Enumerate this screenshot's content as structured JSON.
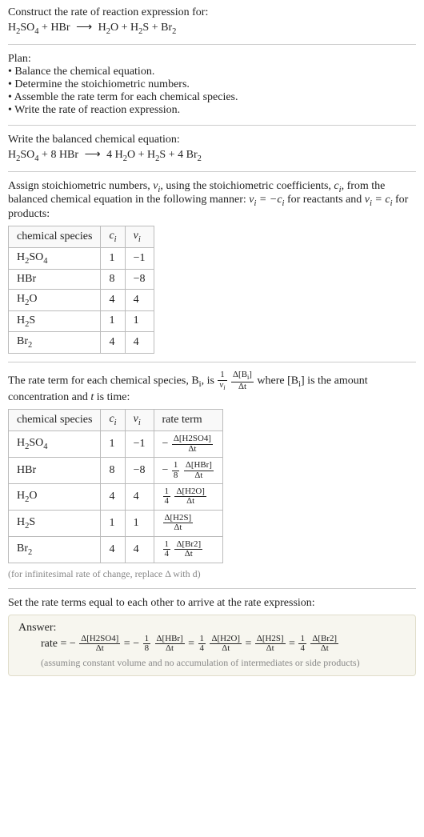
{
  "chart_data": [
    {
      "type": "table",
      "title": "Stoichiometric numbers",
      "columns": [
        "chemical species",
        "c_i",
        "ν_i"
      ],
      "rows": [
        [
          "H2SO4",
          1,
          -1
        ],
        [
          "HBr",
          8,
          -8
        ],
        [
          "H2O",
          4,
          4
        ],
        [
          "H2S",
          1,
          1
        ],
        [
          "Br2",
          4,
          4
        ]
      ]
    },
    {
      "type": "table",
      "title": "Rate terms",
      "columns": [
        "chemical species",
        "c_i",
        "ν_i",
        "rate term"
      ],
      "rows": [
        [
          "H2SO4",
          1,
          -1,
          "-Δ[H2SO4]/Δt"
        ],
        [
          "HBr",
          8,
          -8,
          "-(1/8) Δ[HBr]/Δt"
        ],
        [
          "H2O",
          4,
          4,
          "(1/4) Δ[H2O]/Δt"
        ],
        [
          "H2S",
          1,
          1,
          "Δ[H2S]/Δt"
        ],
        [
          "Br2",
          4,
          4,
          "(1/4) Δ[Br2]/Δt"
        ]
      ]
    }
  ],
  "intro": {
    "construct": "Construct the rate of reaction expression for:"
  },
  "unbalanced": {
    "r1": "H",
    "r1s": "2",
    "r1b": "SO",
    "r1bs": "4",
    "plus1": " + ",
    "r2": "HBr",
    "arrow": "⟶",
    "p1": "H",
    "p1s": "2",
    "p1b": "O",
    "plus2": " + ",
    "p2": "H",
    "p2s": "2",
    "p2b": "S",
    "plus3": " + ",
    "p3": "Br",
    "p3s": "2"
  },
  "plan": {
    "title": "Plan:",
    "b1": "• Balance the chemical equation.",
    "b2": "• Determine the stoichiometric numbers.",
    "b3": "• Assemble the rate term for each chemical species.",
    "b4": "• Write the rate of reaction expression."
  },
  "balanced": {
    "title": "Write the balanced chemical equation:",
    "c2": "8 ",
    "c3": "4 ",
    "c5": "4 "
  },
  "stoich_intro": {
    "p1": "Assign stoichiometric numbers, ",
    "nu": "ν",
    "nus": "i",
    "p2": ", using the stoichiometric coefficients, ",
    "c": "c",
    "cs": "i",
    "p3": ", from the balanced chemical equation in the following manner: ",
    "eq1a": "ν",
    "eq1b": "i",
    "eq1c": " = −c",
    "eq1d": "i",
    "p4": " for reactants and ",
    "eq2a": "ν",
    "eq2b": "i",
    "eq2c": " = c",
    "eq2d": "i",
    "p5": " for products:"
  },
  "table1": {
    "h1": "chemical species",
    "h2": "c",
    "h2s": "i",
    "h3": "ν",
    "h3s": "i",
    "r1c1a": "H",
    "r1c1as": "2",
    "r1c1b": "SO",
    "r1c1bs": "4",
    "r1c2": "1",
    "r1c3": "−1",
    "r2c1": "HBr",
    "r2c2": "8",
    "r2c3": "−8",
    "r3c1a": "H",
    "r3c1as": "2",
    "r3c1b": "O",
    "r3c2": "4",
    "r3c3": "4",
    "r4c1a": "H",
    "r4c1as": "2",
    "r4c1b": "S",
    "r4c2": "1",
    "r4c3": "1",
    "r5c1a": "Br",
    "r5c1as": "2",
    "r5c2": "4",
    "r5c3": "4"
  },
  "rate_intro": {
    "p1": "The rate term for each chemical species, B",
    "s1": "i",
    "p2": ", is ",
    "fr1n": "1",
    "fr1d": "ν",
    "fr1ds": "i",
    "fr2n": "Δ[B",
    "fr2ns": "i",
    "fr2ne": "]",
    "fr2d": "Δt",
    "p3": " where [B",
    "s3": "i",
    "p3e": "] is the amount concentration and ",
    "t": "t",
    "p4": " is time:"
  },
  "table2": {
    "h1": "chemical species",
    "h2": "c",
    "h2s": "i",
    "h3": "ν",
    "h3s": "i",
    "h4": "rate term",
    "r1c2": "1",
    "r1c3": "−1",
    "r1neg": "− ",
    "r1n": "Δ[H2SO4]",
    "r1d": "Δt",
    "r2c2": "8",
    "r2c3": "−8",
    "r2neg": "− ",
    "r2f1n": "1",
    "r2f1d": "8",
    "r2n": "Δ[HBr]",
    "r2d": "Δt",
    "r3c2": "4",
    "r3c3": "4",
    "r3f1n": "1",
    "r3f1d": "4",
    "r3n": "Δ[H2O]",
    "r3d": "Δt",
    "r4c2": "1",
    "r4c3": "1",
    "r4n": "Δ[H2S]",
    "r4d": "Δt",
    "r5c2": "4",
    "r5c3": "4",
    "r5f1n": "1",
    "r5f1d": "4",
    "r5n": "Δ[Br2]",
    "r5d": "Δt"
  },
  "caption": "(for infinitesimal rate of change, replace Δ with d)",
  "setequal": "Set the rate terms equal to each other to arrive at the rate expression:",
  "answer": {
    "label": "Answer:",
    "rate": "rate = − ",
    "t1n": "Δ[H2SO4]",
    "t1d": "Δt",
    "eq": " = − ",
    "f2n": "1",
    "f2d": "8",
    "t2n": "Δ[HBr]",
    "t2d": "Δt",
    "eq2": " = ",
    "f3n": "1",
    "f3d": "4",
    "t3n": "Δ[H2O]",
    "t3d": "Δt",
    "eq3": " = ",
    "t4n": "Δ[H2S]",
    "t4d": "Δt",
    "eq4": " = ",
    "f5n": "1",
    "f5d": "4",
    "t5n": "Δ[Br2]",
    "t5d": "Δt",
    "note": "(assuming constant volume and no accumulation of intermediates or side products)"
  }
}
